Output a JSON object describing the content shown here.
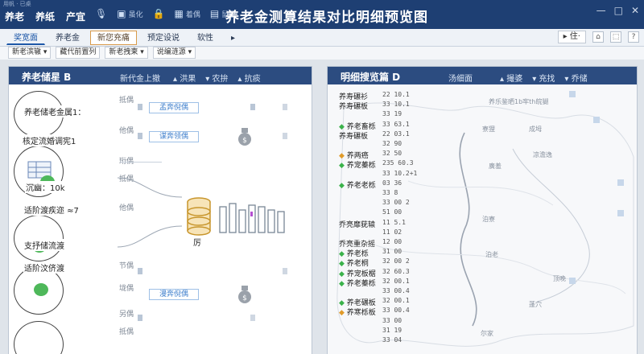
{
  "header": {
    "tiny_title": "用帆 · 已桌",
    "menu": [
      "养老",
      "养纸",
      "产宜"
    ],
    "icons": [
      {
        "name": "mic-icon",
        "glyph": "🎙",
        "label": ""
      },
      {
        "name": "doc-icon",
        "glyph": "▣",
        "label": "虽化"
      },
      {
        "name": "lock-icon",
        "glyph": "🔒",
        "label": ""
      },
      {
        "name": "grid-icon",
        "glyph": "▦",
        "label": "着偶"
      },
      {
        "name": "menu-icon",
        "glyph": "▤",
        "label": "鼠星"
      }
    ],
    "title": "养老金测算结果对比明细预览图",
    "window_controls": [
      "—",
      "□",
      "✕"
    ]
  },
  "tabs": [
    "奖宽面",
    "养老金",
    "新您充痛",
    "预定设说",
    "软性",
    "▸"
  ],
  "active_tab": "新您充痛",
  "toolbar_right": {
    "dropdown": "▸ 住·",
    "icons": [
      "⌂",
      "⬚",
      "?"
    ]
  },
  "filters": [
    "新老滨辙 ▾",
    "藏代前置列",
    "新老拽柬 ▾",
    "说编涟源 ▾"
  ],
  "left_panel": {
    "title": "养老储星 B",
    "subtitle": "新代金上撤",
    "legend": [
      "▴ 洪果",
      "▾ 农拚",
      "▴ 抗痰"
    ],
    "labels": [
      "养老储老金属1：",
      "核定流婚调宪1",
      "沉幽：10k",
      "适阶渡疾迩 ≈7",
      "支抒储流渡",
      "适阶汶侪渡"
    ],
    "row_labels": [
      "抵偶",
      "他偶",
      "珩偶",
      "抵偶",
      "他偶",
      "节偶",
      "垅偶",
      "另偶",
      "抵偶"
    ],
    "buttons": [
      "孟奔倪偶",
      "谋奔领偶",
      "漫奔倪偶"
    ],
    "center_label": "厉"
  },
  "right_panel": {
    "title": "明细搜览篇 D",
    "subtitle": "汤细面",
    "legend": [
      "▴ 撮婆",
      "▾ 充找",
      "▾ 乔储"
    ],
    "rows": [
      {
        "label": "养寿碾衫",
        "mark": "",
        "num": "22   10.1"
      },
      {
        "label": "养寿碾板",
        "mark": "",
        "num": "33   10.1"
      },
      {
        "label": "",
        "mark": "",
        "num": "33   19"
      },
      {
        "label": "养老畜栎",
        "mark": "leaf",
        "num": "33   63.1"
      },
      {
        "label": "养寿碾板",
        "mark": "",
        "num": "22   03.1"
      },
      {
        "label": "",
        "mark": "",
        "num": "32   90"
      },
      {
        "label": "养两癌",
        "mark": "warn",
        "num": "32   50"
      },
      {
        "label": "养宠蓁栎",
        "mark": "leaf",
        "num": "235  60.3"
      },
      {
        "label": "",
        "mark": "",
        "num": "33   10.2+1"
      },
      {
        "label": "养老老栎",
        "mark": "leaf",
        "num": "03   36"
      },
      {
        "label": "",
        "mark": "",
        "num": "33   8"
      },
      {
        "label": "",
        "mark": "",
        "num": "33   00 2"
      },
      {
        "label": "",
        "mark": "",
        "num": "51   00"
      },
      {
        "label": "乔亮靡莸辕",
        "mark": "",
        "num": "11   5.1"
      },
      {
        "label": "",
        "mark": "",
        "num": "11   02"
      },
      {
        "label": "乔亮重杂摇",
        "mark": "",
        "num": "12   00"
      },
      {
        "label": "养老栎",
        "mark": "leaf",
        "num": "31   00"
      },
      {
        "label": "养老桐",
        "mark": "leaf",
        "num": "32   00 2"
      },
      {
        "label": "养宠板椐",
        "mark": "leaf",
        "num": "32   60.3"
      },
      {
        "label": "养老蓁栎",
        "mark": "leaf",
        "num": "32   00.1"
      },
      {
        "label": "",
        "mark": "",
        "num": "33   00.4"
      },
      {
        "label": "养老碾板",
        "mark": "leaf",
        "num": "32   00.1"
      },
      {
        "label": "养寒栎板",
        "mark": "warn",
        "num": "33   00.4"
      },
      {
        "label": "",
        "mark": "",
        "num": "33   00"
      },
      {
        "label": "",
        "mark": "",
        "num": "31   19"
      },
      {
        "label": "",
        "mark": "",
        "num": "33   04"
      }
    ],
    "map_labels": [
      "养乐鉴晒1b牢th皖猢",
      "寮狸",
      "成坶",
      "廣羞",
      "凉澹逸",
      "泊寮",
      "泊老",
      "顶晚",
      "蓬穴",
      "尔家"
    ]
  },
  "colors": {
    "header": "#1e3f73",
    "panel_head": "#2c4c80",
    "accent": "#e09b2a",
    "leaf": "#3bb24b"
  }
}
